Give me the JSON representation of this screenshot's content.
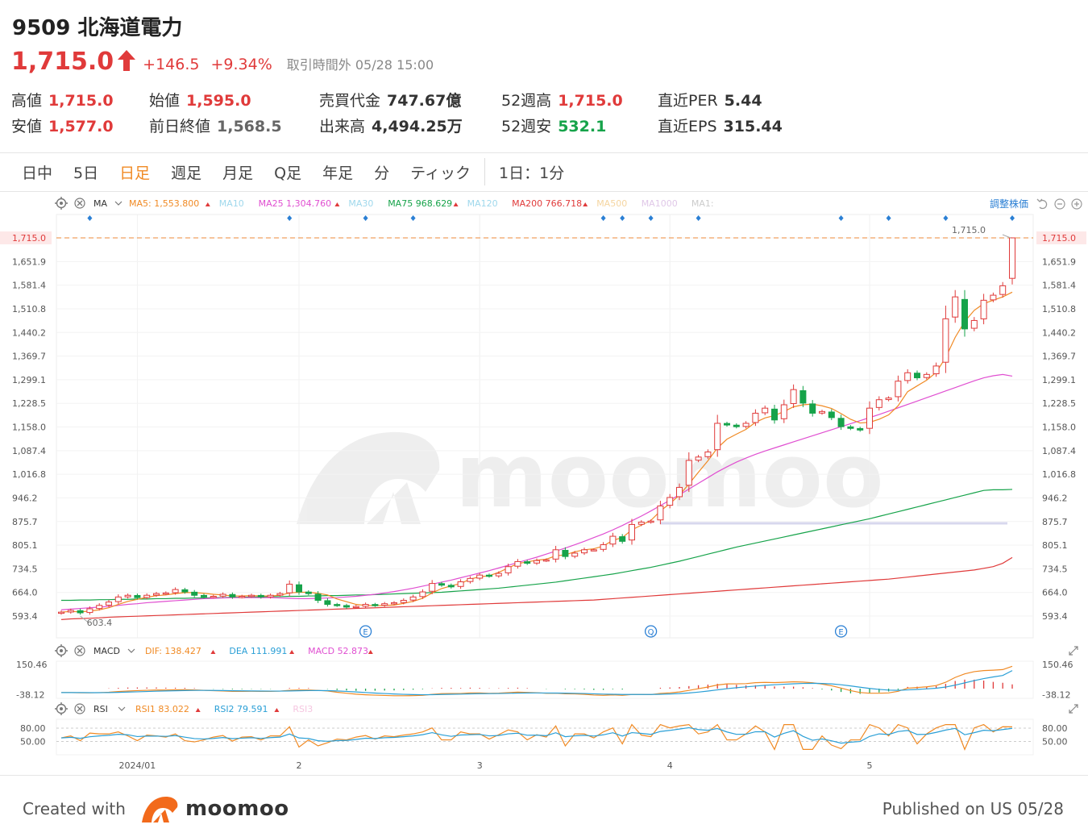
{
  "header": {
    "title": "9509 北海道電力",
    "price": "1,715.0",
    "change": "+146.5",
    "change_pct": "+9.34%",
    "session": "取引時間外 05/28 15:00",
    "up_color": "#e03a3a",
    "down_color": "#16a34a"
  },
  "stats": {
    "high_label": "高値",
    "high": "1,715.0",
    "open_label": "始値",
    "open": "1,595.0",
    "turnover_label": "売買代金",
    "turnover": "747.67億",
    "w52h_label": "52週高",
    "w52h": "1,715.0",
    "per_label": "直近PER",
    "per": "5.44",
    "low_label": "安値",
    "low": "1,577.0",
    "prev_label": "前日終値",
    "prev": "1,568.5",
    "volume_label": "出来高",
    "volume": "4,494.25万",
    "w52l_label": "52週安",
    "w52l": "532.1",
    "eps_label": "直近EPS",
    "eps": "315.44"
  },
  "tabs": [
    "日中",
    "5日",
    "日足",
    "週足",
    "月足",
    "Q足",
    "年足",
    "分",
    "ティック"
  ],
  "active_tab": 2,
  "interval_label": "1日：1分",
  "ma_bar": {
    "label": "MA",
    "items": [
      {
        "name": "MA5:",
        "value": "1,553.800",
        "color": "#f08a24",
        "active": true
      },
      {
        "name": "MA10",
        "value": "",
        "color": "#9fd8ec",
        "active": false
      },
      {
        "name": "MA25",
        "value": "1,304.760",
        "color": "#e04fd1",
        "active": true
      },
      {
        "name": "MA30",
        "value": "",
        "color": "#9fd8ec",
        "active": false
      },
      {
        "name": "MA75",
        "value": "968.629",
        "color": "#16a34a",
        "active": true
      },
      {
        "name": "MA120",
        "value": "",
        "color": "#9fd8ec",
        "active": false
      },
      {
        "name": "MA200",
        "value": "766.718",
        "color": "#e03a3a",
        "active": true
      },
      {
        "name": "MA500",
        "value": "",
        "color": "#f5d5a0",
        "active": false
      },
      {
        "name": "MA1000",
        "value": "",
        "color": "#e0c8e8",
        "active": false
      },
      {
        "name": "MA1:",
        "value": "",
        "color": "#cccccc",
        "active": false
      }
    ],
    "adjust_label": "調整株価"
  },
  "macd_bar": {
    "label": "MACD",
    "items": [
      {
        "name": "DIF:",
        "value": "138.427",
        "color": "#f08a24"
      },
      {
        "name": "DEA",
        "value": "111.991",
        "color": "#2a9fd6"
      },
      {
        "name": "MACD",
        "value": "52.873",
        "color": "#e04fd1"
      }
    ]
  },
  "rsi_bar": {
    "label": "RSI",
    "items": [
      {
        "name": "RSI1",
        "value": "83.022",
        "color": "#f08a24"
      },
      {
        "name": "RSI2",
        "value": "79.591",
        "color": "#2a9fd6"
      },
      {
        "name": "RSI3",
        "value": "",
        "color": "#f5c6e0"
      }
    ]
  },
  "chart_data": [
    {
      "type": "candlestick",
      "ylim": [
        560,
        1740
      ],
      "y_ticks": [
        "1,715.0",
        "1,651.9",
        "1,581.4",
        "1,510.8",
        "1,440.2",
        "1,369.7",
        "1,299.1",
        "1,228.5",
        "1,158.0",
        "1,087.4",
        "1,016.8",
        "946.2",
        "875.7",
        "805.1",
        "734.5",
        "664.0",
        "593.4"
      ],
      "x_ticks": [
        {
          "label": "2024/01",
          "index": 8
        },
        {
          "label": "2",
          "index": 25
        },
        {
          "label": "3",
          "index": 44
        },
        {
          "label": "4",
          "index": 64
        },
        {
          "label": "5",
          "index": 85
        }
      ],
      "closes": [
        605,
        610,
        603,
        615,
        625,
        635,
        650,
        655,
        648,
        655,
        660,
        662,
        672,
        665,
        655,
        650,
        652,
        658,
        650,
        652,
        655,
        650,
        655,
        660,
        688,
        665,
        660,
        640,
        628,
        625,
        620,
        622,
        628,
        625,
        630,
        633,
        640,
        650,
        665,
        690,
        685,
        680,
        695,
        705,
        715,
        712,
        720,
        740,
        755,
        750,
        758,
        760,
        790,
        770,
        780,
        790,
        790,
        805,
        830,
        815,
        865,
        872,
        875,
        920,
        945,
        975,
        1055,
        1065,
        1080,
        1165,
        1160,
        1155,
        1165,
        1195,
        1210,
        1175,
        1220,
        1265,
        1225,
        1195,
        1200,
        1182,
        1155,
        1150,
        1145,
        1210,
        1235,
        1240,
        1290,
        1315,
        1300,
        1310,
        1335,
        1475,
        1540,
        1445,
        1470,
        1530,
        1545,
        1573,
        1715
      ],
      "ma5": [
        605,
        607,
        606,
        608,
        612,
        618,
        628,
        637,
        643,
        649,
        654,
        656,
        660,
        663,
        663,
        661,
        658,
        656,
        653,
        653,
        654,
        653,
        653,
        655,
        662,
        664,
        664,
        661,
        656,
        644,
        636,
        628,
        625,
        624,
        625,
        626,
        631,
        637,
        646,
        662,
        675,
        683,
        690,
        703,
        710,
        713,
        723,
        736,
        749,
        754,
        759,
        762,
        772,
        775,
        784,
        790,
        793,
        801,
        818,
        826,
        849,
        863,
        877,
        905,
        927,
        952,
        985,
        1020,
        1054,
        1092,
        1118,
        1133,
        1147,
        1168,
        1181,
        1188,
        1200,
        1214,
        1220,
        1222,
        1217,
        1209,
        1194,
        1177,
        1166,
        1168,
        1177,
        1190,
        1217,
        1259,
        1276,
        1293,
        1316,
        1360,
        1420,
        1467,
        1500,
        1520,
        1530,
        1540,
        1554
      ],
      "ma25": [
        612,
        614,
        616,
        618,
        620,
        622,
        625,
        628,
        630,
        633,
        635,
        637,
        639,
        641,
        643,
        645,
        646,
        647,
        648,
        648,
        648,
        648,
        648,
        647,
        646,
        645,
        645,
        646,
        647,
        648,
        650,
        652,
        655,
        658,
        662,
        666,
        671,
        676,
        682,
        688,
        694,
        700,
        707,
        714,
        721,
        728,
        736,
        744,
        752,
        760,
        768,
        777,
        786,
        795,
        805,
        815,
        826,
        837,
        849,
        862,
        876,
        890,
        905,
        921,
        937,
        953,
        970,
        987,
        1004,
        1021,
        1036,
        1050,
        1062,
        1073,
        1083,
        1092,
        1101,
        1110,
        1119,
        1128,
        1137,
        1146,
        1155,
        1164,
        1173,
        1182,
        1191,
        1201,
        1211,
        1221,
        1231,
        1241,
        1251,
        1261,
        1271,
        1281,
        1291,
        1300,
        1306,
        1310,
        1305
      ],
      "ma75": [
        640,
        640,
        641,
        641,
        642,
        642,
        643,
        643,
        644,
        644,
        645,
        645,
        646,
        646,
        647,
        647,
        648,
        648,
        649,
        649,
        650,
        650,
        651,
        651,
        652,
        652,
        653,
        653,
        654,
        654,
        655,
        656,
        656,
        657,
        658,
        659,
        660,
        661,
        662,
        663,
        664,
        666,
        668,
        670,
        672,
        674,
        676,
        679,
        682,
        685,
        688,
        691,
        694,
        698,
        702,
        706,
        710,
        714,
        718,
        723,
        728,
        733,
        738,
        744,
        750,
        756,
        763,
        770,
        777,
        784,
        791,
        798,
        804,
        810,
        816,
        822,
        828,
        834,
        840,
        846,
        852,
        858,
        864,
        870,
        876,
        882,
        889,
        896,
        903,
        910,
        917,
        924,
        931,
        938,
        945,
        952,
        959,
        966,
        968,
        968,
        969
      ],
      "ma200": [
        583,
        585,
        586,
        587,
        588,
        590,
        591,
        592,
        593,
        594,
        595,
        596,
        597,
        598,
        599,
        600,
        601,
        602,
        603,
        604,
        605,
        606,
        607,
        608,
        609,
        610,
        611,
        612,
        613,
        614,
        615,
        616,
        617,
        618,
        619,
        620,
        621,
        622,
        623,
        624,
        625,
        626,
        627,
        628,
        629,
        630,
        631,
        632,
        633,
        634,
        635,
        636,
        637,
        638,
        639,
        640,
        641,
        643,
        645,
        647,
        649,
        651,
        653,
        655,
        657,
        659,
        661,
        663,
        665,
        667,
        669,
        671,
        673,
        675,
        677,
        679,
        681,
        683,
        685,
        687,
        689,
        691,
        693,
        695,
        697,
        699,
        701,
        703,
        706,
        709,
        712,
        715,
        718,
        721,
        724,
        727,
        730,
        735,
        740,
        750,
        767
      ],
      "events": [
        {
          "label": "E",
          "index": 32
        },
        {
          "label": "Q",
          "index": 62
        },
        {
          "label": "E",
          "index": 82
        }
      ],
      "markers": [
        3,
        24,
        32,
        37,
        57,
        59,
        62,
        67,
        82,
        87,
        93,
        100
      ],
      "annotations": {
        "high_label": "1,715.0",
        "low_label": "603.4",
        "low_index": 2
      },
      "ref_line": "1,715.0"
    },
    {
      "type": "line",
      "name": "MACD",
      "ylim": [
        -60,
        170
      ],
      "y_ticks": [
        "150.46",
        "-38.12"
      ]
    },
    {
      "type": "line",
      "name": "RSI",
      "ylim": [
        20,
        100
      ],
      "y_ticks": [
        "80.00",
        "50.00"
      ]
    }
  ],
  "footer": {
    "created_with": "Created with",
    "brand": "moomoo",
    "published": "Published on US 05/28"
  }
}
